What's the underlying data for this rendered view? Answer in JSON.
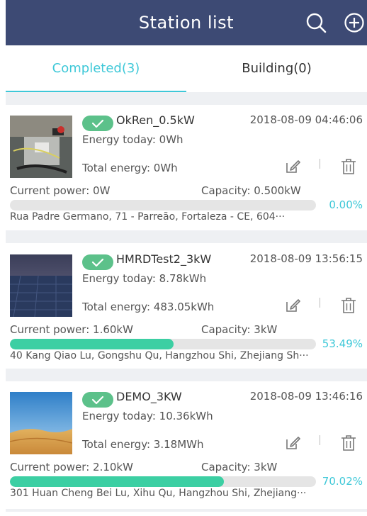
{
  "header": {
    "title": "Station list",
    "bg_color": "#3d4a74",
    "icons": [
      "search-icon",
      "add-circle-icon"
    ]
  },
  "tabs": [
    {
      "label": "Completed(3)",
      "active": true,
      "color": "#3ec8d8"
    },
    {
      "label": "Building(0)",
      "active": false
    }
  ],
  "stations": [
    {
      "name": "OkRen_0.5kW",
      "date": "2018-08-09 04:46:06",
      "energy_today": "Energy today: 0Wh",
      "total_energy": "Total energy: 0Wh",
      "current_power": "Current power: 0W",
      "capacity": "Capacity: 0.500kW",
      "progress_percent": 0.0,
      "progress_text": "0.00%",
      "address": "Rua Padre Germano, 71 - Parreão, Fortaleza - CE, 604···"
    },
    {
      "name": "HMRDTest2_3kW",
      "date": "2018-08-09 13:56:15",
      "energy_today": "Energy today: 8.78kWh",
      "total_energy": "Total energy: 483.05kWh",
      "current_power": "Current power: 1.60kW",
      "capacity": "Capacity: 3kW",
      "progress_percent": 53.49,
      "progress_text": "53.49%",
      "address": "40 Kang Qiao Lu, Gongshu Qu, Hangzhou Shi, Zhejiang Sh···"
    },
    {
      "name": "DEMO_3KW",
      "date": "2018-08-09 13:46:16",
      "energy_today": "Energy today: 10.36kWh",
      "total_energy": "Total energy: 3.18MWh",
      "current_power": "Current power: 2.10kW",
      "capacity": "Capacity: 3kW",
      "progress_percent": 70.02,
      "progress_text": "70.02%",
      "address": "301 Huan Cheng Bei Lu, Xihu Qu, Hangzhou Shi, Zhejiang···"
    }
  ],
  "colors": {
    "accent": "#3ec8d8",
    "progress_fill": "#3ccfa3",
    "check_badge": "#5cc18a"
  }
}
